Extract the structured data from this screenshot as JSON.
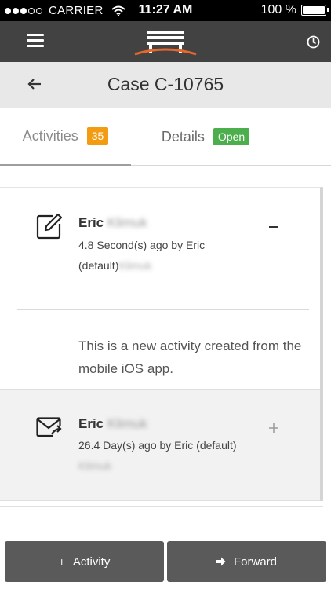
{
  "status_bar": {
    "carrier": "CARRIER",
    "time": "11:27 AM",
    "battery_text": "100 %",
    "battery_level": 1.0,
    "signal_bars_filled": 3,
    "signal_bars_total": 5
  },
  "nav": {
    "menu_icon": "hamburger-menu-icon",
    "logo_icon": "bench-logo-icon",
    "history_icon": "clock-icon"
  },
  "header": {
    "title": "Case C-10765",
    "back_icon": "arrow-left-icon"
  },
  "tabs": [
    {
      "label": "Activities",
      "badge": "35",
      "badge_color": "#f39c12",
      "selected": true
    },
    {
      "label": "Details",
      "badge": "Open",
      "badge_color": "#4cae4c",
      "selected": false
    }
  ],
  "activities": [
    {
      "icon": "edit-note-icon",
      "name_first": "Eric",
      "name_last": "Klimuk",
      "meta_line": "4.8 Second(s) ago by Eric",
      "meta_line2_visible": "(default)",
      "meta_line2_blurred": "Klimuk",
      "toggle_icon": "minus-icon",
      "expanded": true,
      "body": "This is a new activity created from the mobile iOS app."
    },
    {
      "icon": "email-forward-icon",
      "name_first": "Eric",
      "name_last": "Klimuk",
      "meta_line": "26.4 Day(s) ago by Eric (default)",
      "meta_line2_blurred": "Klimuk",
      "toggle_icon": "plus-icon",
      "expanded": false
    }
  ],
  "bottom_actions": [
    {
      "label": "Activity",
      "icon": "plus-icon"
    },
    {
      "label": "Forward",
      "icon": "arrow-right-icon"
    }
  ]
}
